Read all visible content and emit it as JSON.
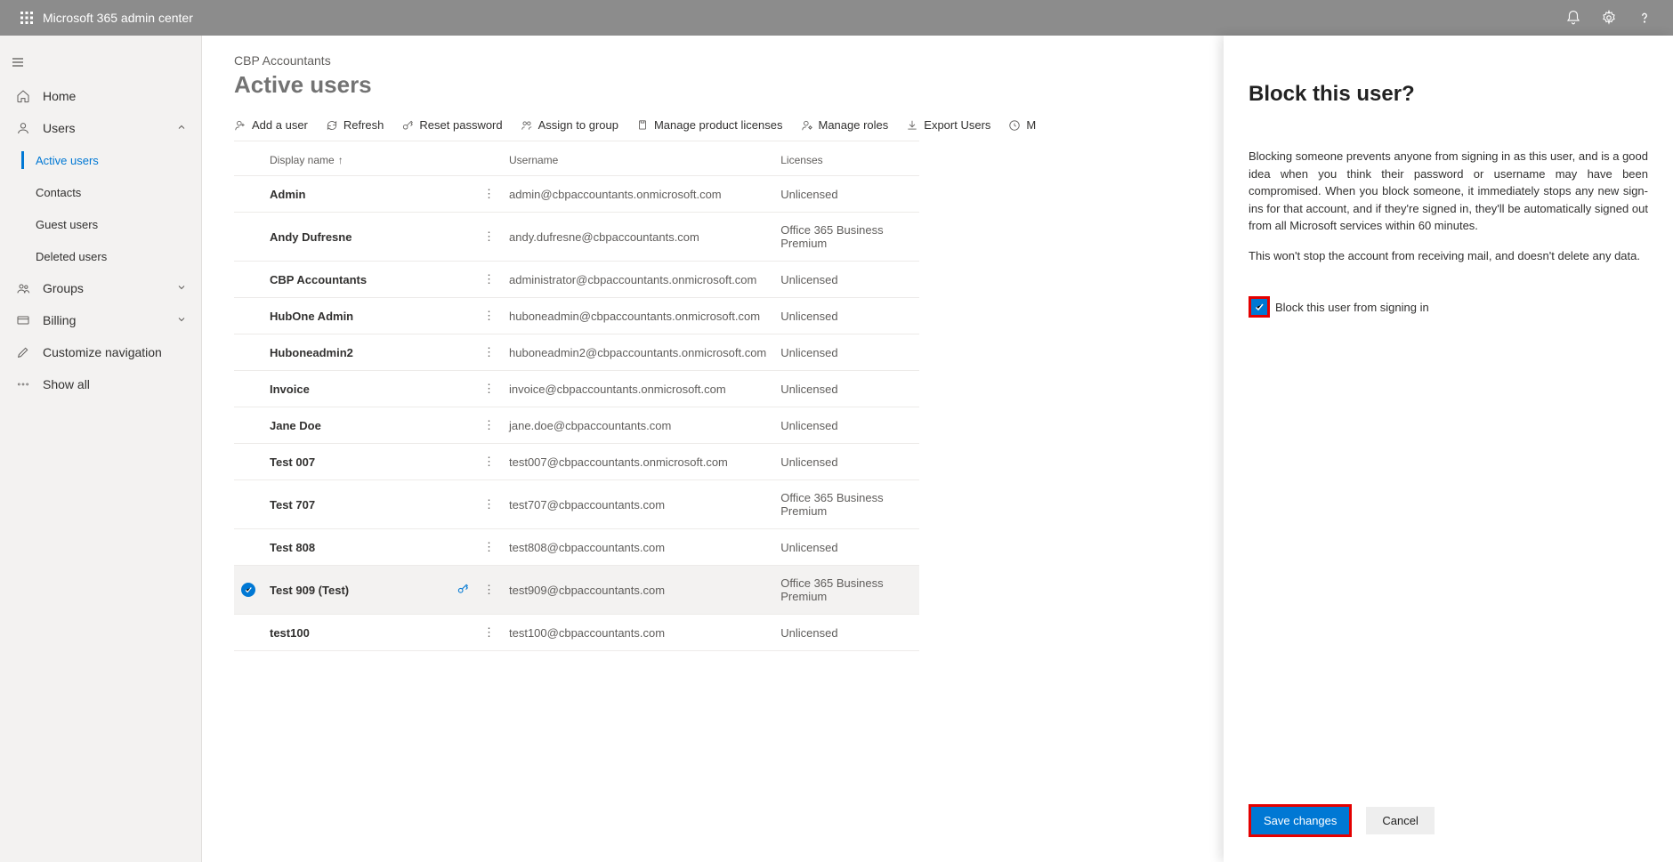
{
  "topbar": {
    "title": "Microsoft 365 admin center"
  },
  "nav": {
    "home": "Home",
    "users": "Users",
    "users_sub": {
      "active": "Active users",
      "contacts": "Contacts",
      "guest": "Guest users",
      "deleted": "Deleted users"
    },
    "groups": "Groups",
    "billing": "Billing",
    "customize": "Customize navigation",
    "showall": "Show all"
  },
  "main": {
    "breadcrumb": "CBP Accountants",
    "title": "Active users",
    "cmd": {
      "add": "Add a user",
      "refresh": "Refresh",
      "reset": "Reset password",
      "assign": "Assign to group",
      "licenses": "Manage product licenses",
      "roles": "Manage roles",
      "export": "Export Users",
      "more": "M"
    },
    "cols": {
      "display": "Display name",
      "user": "Username",
      "lic": "Licenses"
    },
    "rows": [
      {
        "dn": "Admin",
        "user": "admin@cbpaccountants.onmicrosoft.com",
        "lic": "Unlicensed"
      },
      {
        "dn": "Andy Dufresne",
        "user": "andy.dufresne@cbpaccountants.com",
        "lic": "Office 365 Business Premium"
      },
      {
        "dn": "CBP Accountants",
        "user": "administrator@cbpaccountants.onmicrosoft.com",
        "lic": "Unlicensed"
      },
      {
        "dn": "HubOne Admin",
        "user": "huboneadmin@cbpaccountants.onmicrosoft.com",
        "lic": "Unlicensed"
      },
      {
        "dn": "Huboneadmin2",
        "user": "huboneadmin2@cbpaccountants.onmicrosoft.com",
        "lic": "Unlicensed"
      },
      {
        "dn": "Invoice",
        "user": "invoice@cbpaccountants.onmicrosoft.com",
        "lic": "Unlicensed"
      },
      {
        "dn": "Jane Doe",
        "user": "jane.doe@cbpaccountants.com",
        "lic": "Unlicensed"
      },
      {
        "dn": "Test 007",
        "user": "test007@cbpaccountants.onmicrosoft.com",
        "lic": "Unlicensed"
      },
      {
        "dn": "Test 707",
        "user": "test707@cbpaccountants.com",
        "lic": "Office 365 Business Premium"
      },
      {
        "dn": "Test 808",
        "user": "test808@cbpaccountants.com",
        "lic": "Unlicensed"
      },
      {
        "dn": "Test 909 (Test)",
        "user": "test909@cbpaccountants.com",
        "lic": "Office 365 Business Premium"
      },
      {
        "dn": "test100",
        "user": "test100@cbpaccountants.com",
        "lic": "Unlicensed"
      }
    ],
    "selected_index": 10
  },
  "panel": {
    "title": "Block this user?",
    "p1": "Blocking someone prevents anyone from signing in as this user, and is a good idea when you think their password or username may have been compromised. When you block someone, it immediately stops any new sign-ins for that account, and if they're signed in, they'll be automatically signed out from all Microsoft services within 60 minutes.",
    "p2": "This won't stop the account from receiving mail, and doesn't delete any data.",
    "cb_label": "Block this user from signing in",
    "save": "Save changes",
    "cancel": "Cancel"
  }
}
